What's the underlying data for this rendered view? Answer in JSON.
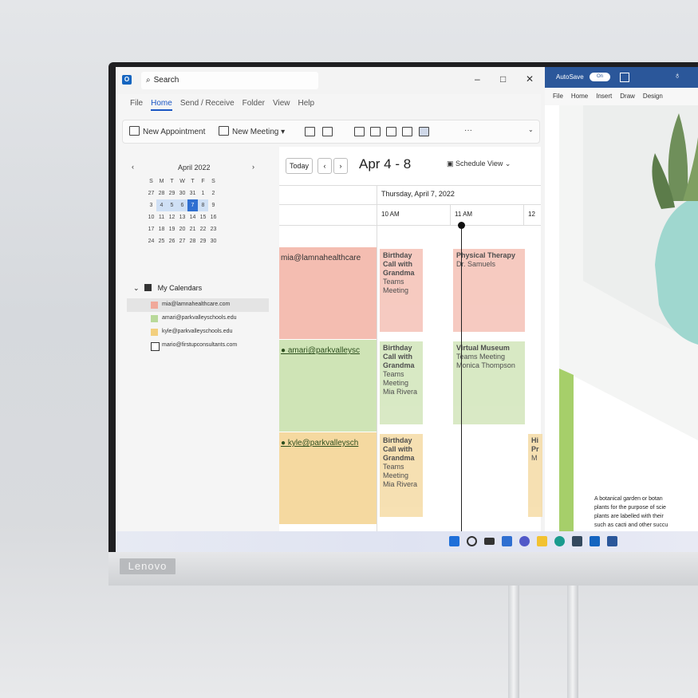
{
  "device": {
    "brand": "Lenovo"
  },
  "outlook": {
    "search_placeholder": "Search",
    "window_controls": {
      "minimize": "–",
      "maximize": "□",
      "close": "✕"
    },
    "menu": [
      "File",
      "Home",
      "Send / Receive",
      "Folder",
      "View",
      "Help"
    ],
    "active_menu": "Home",
    "ribbon": {
      "new_appointment": "New Appointment",
      "new_meeting": "New Meeting",
      "more": "···"
    },
    "mini_calendar": {
      "month": "April 2022",
      "prev": "‹",
      "next": "›",
      "weekdays": [
        "S",
        "M",
        "T",
        "W",
        "T",
        "F",
        "S"
      ],
      "weeks": [
        [
          "27",
          "28",
          "29",
          "30",
          "31",
          "1",
          "2"
        ],
        [
          "3",
          "4",
          "5",
          "6",
          "7",
          "8",
          "9"
        ],
        [
          "10",
          "11",
          "12",
          "13",
          "14",
          "15",
          "16"
        ],
        [
          "17",
          "18",
          "19",
          "20",
          "21",
          "22",
          "23"
        ],
        [
          "24",
          "25",
          "26",
          "27",
          "28",
          "29",
          "30"
        ]
      ],
      "selected_day": "7"
    },
    "calendars": {
      "group_label": "My Calendars",
      "items": [
        {
          "label": "mia@lamnahealthcare.com",
          "color": "#f0a99a"
        },
        {
          "label": "amari@parkvalleyschools.edu",
          "color": "#b9d99a"
        },
        {
          "label": "kyle@parkvalleyschools.edu",
          "color": "#f2cf7e"
        },
        {
          "label": "mario@firstupconsultants.com",
          "color": "#ffffff"
        }
      ]
    },
    "schedule": {
      "today_label": "Today",
      "prev": "‹",
      "next": "›",
      "range": "Apr 4 - 8",
      "view_label": "Schedule View",
      "date_header": "Thursday, April 7, 2022",
      "times": [
        "10 AM",
        "11 AM",
        "12"
      ],
      "rows": [
        {
          "email": "mia@lamnahealthcare",
          "color": "#f4bdb1",
          "events": [
            {
              "title": "Birthday Call with Grandma",
              "detail": "Teams Meeting"
            },
            {
              "title": "Physical Therapy",
              "detail": "Dr. Samuels"
            }
          ]
        },
        {
          "email": "amari@parkvalleysc",
          "color": "#cfe4b6",
          "events": [
            {
              "title": "Birthday Call with Grandma",
              "detail": "Teams Meeting Mia Rivera"
            },
            {
              "title": "Virtual Museum",
              "detail": "Teams Meeting Monica Thompson"
            }
          ]
        },
        {
          "email": "kyle@parkvalleysch",
          "color": "#f5d9a0",
          "events": [
            {
              "title": "Birthday Call with Grandma",
              "detail": "Teams Meeting Mia Rivera"
            },
            {
              "title": "Hi Pr",
              "detail": "M"
            }
          ]
        }
      ]
    }
  },
  "word": {
    "autosave": "AutoSave",
    "toggle": "On",
    "menu": [
      "File",
      "Home",
      "Insert",
      "Draw",
      "Design"
    ],
    "text_lines": [
      "A botanical garden or botan",
      "plants for the purpose of scie",
      "plants are labelled with their",
      "such as cacti and other succu"
    ]
  }
}
